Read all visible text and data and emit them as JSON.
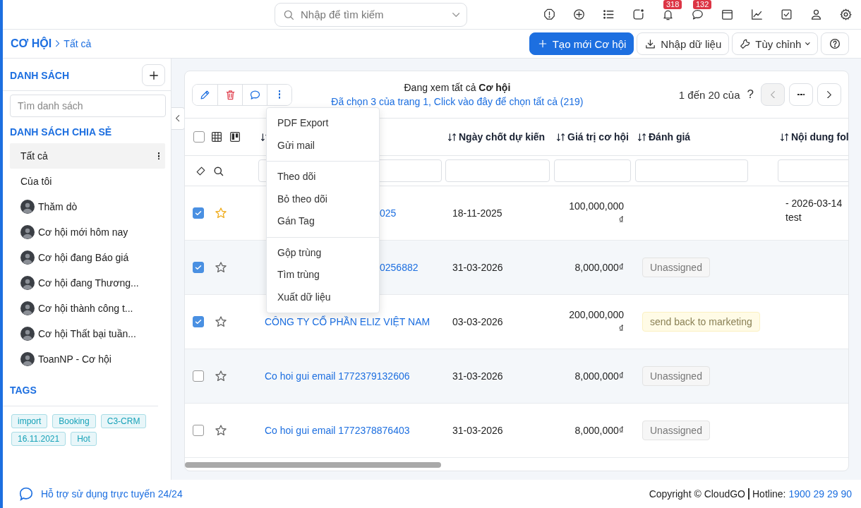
{
  "topbar": {
    "search": {
      "placeholder": "Nhập để tìm kiếm"
    },
    "notification_count": "318",
    "message_count": "132"
  },
  "header": {
    "module": "CƠ HỘI",
    "current": "Tất cả",
    "create_button": "Tạo mới Cơ hội",
    "import_button": "Nhập dữ liệu",
    "customize_button": "Tùy chỉnh"
  },
  "sidebar": {
    "lists_title": "DANH SÁCH",
    "search": {
      "placeholder": "Tìm danh sách"
    },
    "shared_title": "DANH SÁCH CHIA SẺ",
    "items": [
      {
        "label": "Tất cả",
        "selected": true,
        "kind": "plain"
      },
      {
        "label": "Của tôi",
        "selected": false,
        "kind": "plain"
      },
      {
        "label": "Thăm dò",
        "selected": false,
        "kind": "owned"
      },
      {
        "label": "Cơ hội mới hôm nay",
        "selected": false,
        "kind": "owned"
      },
      {
        "label": "Cơ hội đang Báo giá",
        "selected": false,
        "kind": "owned"
      },
      {
        "label": "Cơ hội đang Thương...",
        "selected": false,
        "kind": "owned"
      },
      {
        "label": "Cơ hội thành công t...",
        "selected": false,
        "kind": "owned"
      },
      {
        "label": "Cơ hội Thất bại tuần...",
        "selected": false,
        "kind": "owned"
      },
      {
        "label": "ToanNP - Cơ hội",
        "selected": false,
        "kind": "owned"
      }
    ],
    "tags_title": "TAGS",
    "tags": [
      "import",
      "Booking",
      "C3-CRM",
      "16.11.2021",
      "Hot"
    ]
  },
  "list": {
    "select_all_checked": false,
    "summary": "Đang xem tất cả **Cơ hội**",
    "selection_link": "Đã chọn 3 của trang 1, Click vào đây để chọn tất cả (219)",
    "paging": "1 đến 20 của",
    "paging_total": "?",
    "columns": [
      {
        "kind": "covered"
      },
      {
        "kind": "sortable",
        "label": "Ngày chốt dự kiến"
      },
      {
        "kind": "sortable",
        "label": "Giá trị cơ hội"
      },
      {
        "kind": "sortable",
        "label": "Đánh giá"
      },
      {
        "kind": "sortable",
        "label": "Nội dung fol"
      }
    ],
    "rows": [
      {
        "checked": true,
        "starred": true,
        "name_tail": "025",
        "close_date": "18-11-2025",
        "value": "100,000,000₫",
        "content": [
          "- 2026-03-14",
          "test"
        ]
      },
      {
        "checked": true,
        "starred": false,
        "name_tail": "0256882",
        "close_date": "31-03-2026",
        "value": "8,000,000₫",
        "rating": {
          "label": "Unassigned",
          "kind": "neutral"
        }
      },
      {
        "checked": true,
        "starred": false,
        "name": "CÔNG TY CỔ PHẦN ELIZ VIỆT NAM",
        "close_date": "03-03-2026",
        "value": "200,000,000₫",
        "rating": {
          "label": "send back to marketing",
          "kind": "warning"
        }
      },
      {
        "checked": false,
        "starred": false,
        "name": "Co hoi gui email 1772379132606",
        "close_date": "31-03-2026",
        "value": "8,000,000₫",
        "rating": {
          "label": "Unassigned",
          "kind": "neutral"
        }
      },
      {
        "checked": false,
        "starred": false,
        "name": "Co hoi gui email 1772378876403",
        "close_date": "31-03-2026",
        "value": "8,000,000₫",
        "rating": {
          "label": "Unassigned",
          "kind": "neutral"
        }
      }
    ],
    "menu": {
      "groups": [
        [
          "PDF Export",
          "Gửi mail"
        ],
        [
          "Theo dõi",
          "Bỏ theo dõi",
          "Gán Tag"
        ],
        [
          "Gộp trùng",
          "Tìm trùng",
          "Xuất dữ liệu"
        ]
      ]
    }
  },
  "footer": {
    "support": "Hỗ trợ sử dụng trực tuyến 24/24",
    "copyright": "Copyright © CloudGO",
    "hotline_label": "Hotline:",
    "hotline": "1900 29 29 90"
  }
}
